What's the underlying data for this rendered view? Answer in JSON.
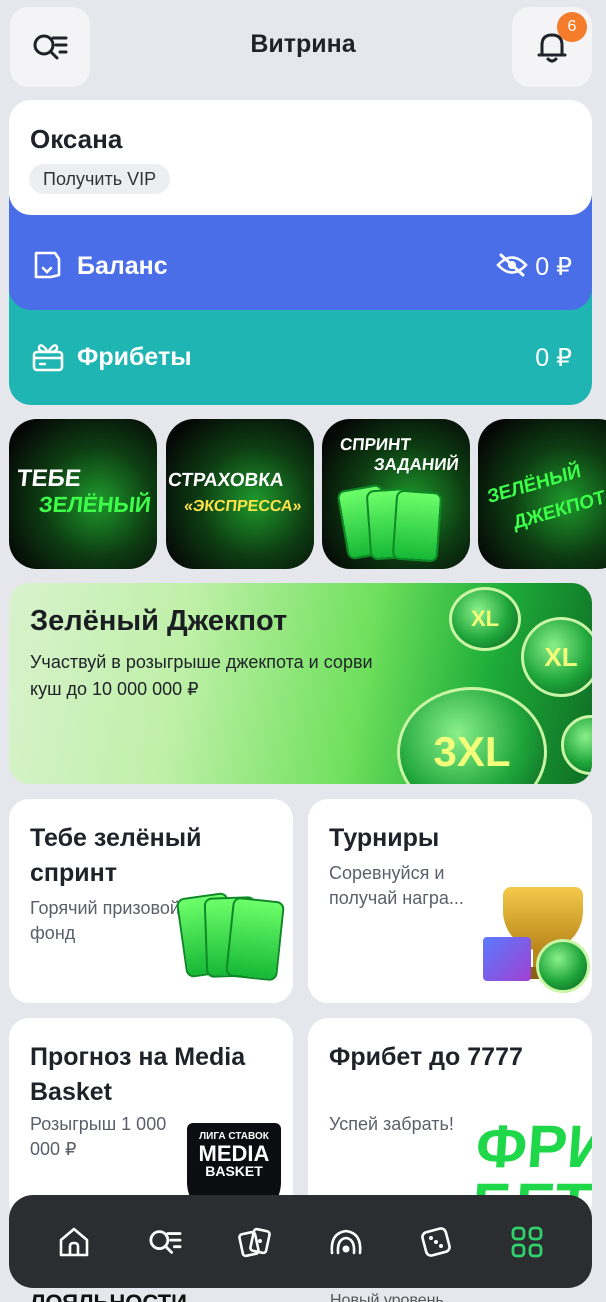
{
  "header": {
    "title": "Витрина",
    "notifications_count": "6",
    "search_icon": "search-filter-icon",
    "bell_icon": "bell-icon"
  },
  "profile": {
    "name": "Оксана",
    "vip_button": "Получить VIP"
  },
  "balance": {
    "label": "Баланс",
    "amount": "0 ₽",
    "color": "#4a6ee8",
    "hide_icon": "eye-off-icon"
  },
  "freebets": {
    "label": "Фрибеты",
    "amount": "0 ₽",
    "color": "#1fb5b3"
  },
  "stories": [
    {
      "line1": "ТЕБЕ",
      "line2": "ЗЕЛЁНЫЙ"
    },
    {
      "line1": "СТРАХОВКА",
      "line2": "«ЭКСПРЕССА»"
    },
    {
      "line1": "СПРИНТ",
      "line2": "ЗАДАНИЙ"
    },
    {
      "line1": "ЗЕЛЁНЫЙ",
      "line2": "ДЖЕКПОТ"
    }
  ],
  "jackpot": {
    "title": "Зелёный Джекпот",
    "description": "Участвуй в розыгрыше джекпота и сорви куш до 10 000 000 ₽",
    "coin_label": "3XL",
    "coin_label_small": "XL"
  },
  "cards": [
    {
      "title": "Тебе зелёный спринт",
      "subtitle": "Горячий призовой фонд"
    },
    {
      "title": "Турниры",
      "subtitle": "Соревнуйся и получай награ..."
    },
    {
      "title": "Прогноз на Media Basket",
      "subtitle": "Розыгрыш 1 000 000 ₽",
      "logo_l1": "ЛИГА СТАВОК",
      "logo_l2": "MEDIA",
      "logo_l3": "BASKET"
    },
    {
      "title": "Фрибет до 7777",
      "subtitle": "Успей забрать!",
      "badge_text": "ФРИ БЕТ"
    }
  ],
  "below_fold": {
    "left": "ЛОЯЛЬНОСТИ",
    "right": "Новый уровень"
  },
  "tabbar": {
    "items": [
      "home-icon",
      "search-filter-icon",
      "cards-icon",
      "live-icon",
      "dice-icon",
      "grid-icon"
    ],
    "active_color": "#2fd16a"
  }
}
